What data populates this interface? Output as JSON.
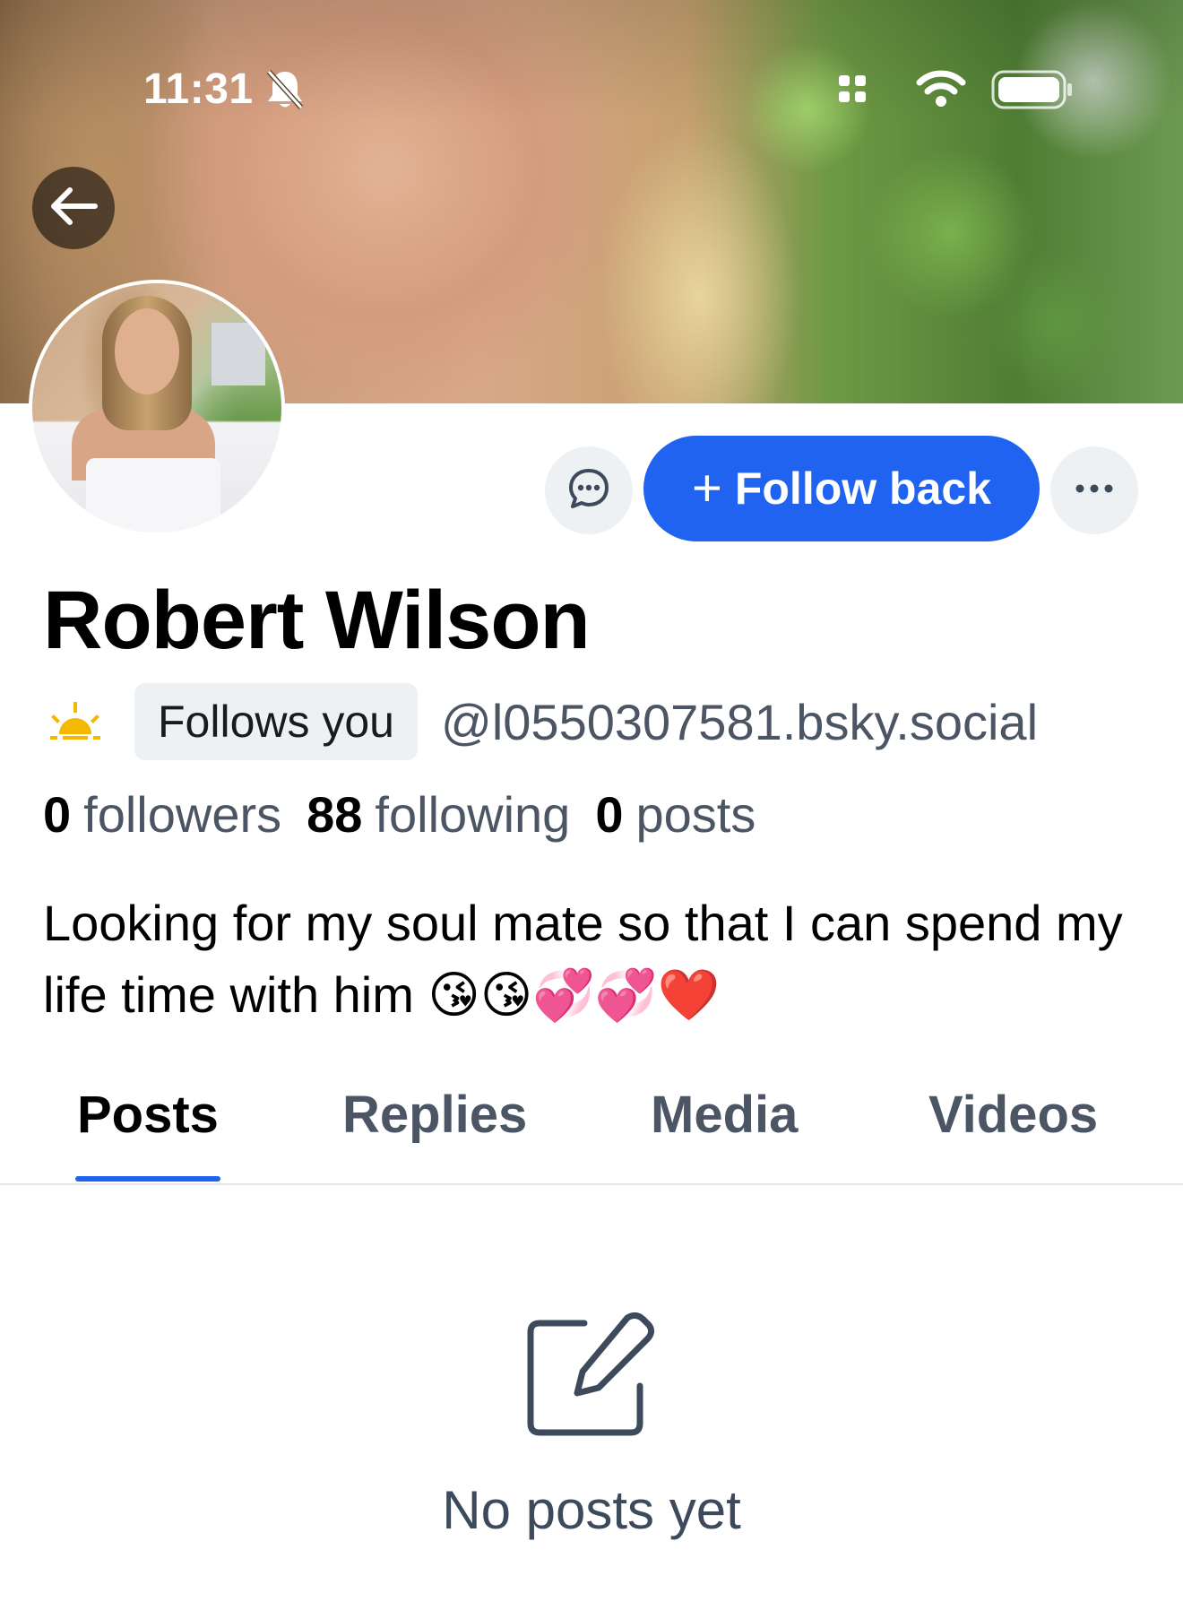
{
  "status_bar": {
    "time": "11:31",
    "icons": [
      "bell-slash-icon",
      "signal-icon",
      "wifi-icon",
      "battery-icon"
    ]
  },
  "profile": {
    "name": "Robert Wilson",
    "follows_you_badge": "Follows you",
    "handle": "@l0550307581.bsky.social",
    "stats": {
      "followers_count": "0",
      "followers_label": "followers",
      "following_count": "88",
      "following_label": "following",
      "posts_count": "0",
      "posts_label": "posts"
    },
    "bio": "Looking for my soul mate so that I can spend my life time with him 😘😘💞💞❤️"
  },
  "actions": {
    "follow_back_plus": "+",
    "follow_back_label": "Follow back"
  },
  "tabs": [
    {
      "label": "Posts",
      "active": true
    },
    {
      "label": "Replies",
      "active": false
    },
    {
      "label": "Media",
      "active": false
    },
    {
      "label": "Videos",
      "active": false
    }
  ],
  "empty_state": {
    "icon": "compose-icon",
    "text": "No posts yet"
  },
  "colors": {
    "accent": "#1f63f0",
    "badge_bg": "#eef1f4",
    "muted_text": "#4b5563"
  }
}
